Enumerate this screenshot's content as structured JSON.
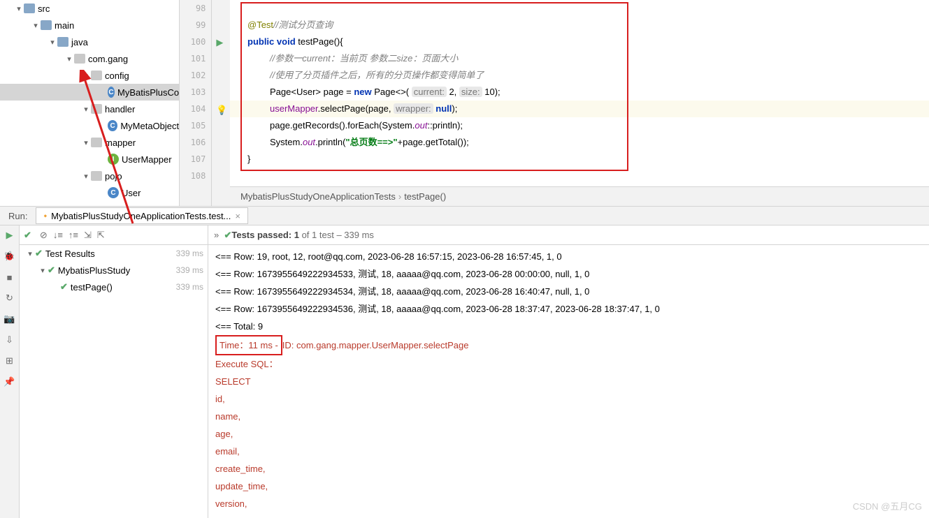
{
  "tree": {
    "src": "src",
    "main": "main",
    "java": "java",
    "pkg": "com.gang",
    "config": "config",
    "mbp": "MyBatisPlusCo",
    "handler": "handler",
    "meta": "MyMetaObject",
    "mapper": "mapper",
    "um": "UserMapper",
    "pojo": "pojo",
    "user": "User"
  },
  "lines": [
    "98",
    "99",
    "100",
    "101",
    "102",
    "103",
    "104",
    "105",
    "106",
    "107",
    "108"
  ],
  "code": {
    "ann": "@Test",
    "com0": "//测试分页查询",
    "kw_pub": "public",
    "kw_void": "void",
    "fn": "testPage(){",
    "com1": "//参数一current：当前页   参数二size：页面大小",
    "com2": "//使用了分页插件之后，所有的分页操作都变得简单了",
    "l3a": "Page<User> page = ",
    "kw_new": "new",
    "l3b": " Page<>( ",
    "h1": "current:",
    "v1": " 2, ",
    "h2": "size:",
    "v2": " 10);",
    "l4a": "userMapper",
    "l4b": ".selectPage(page, ",
    "h3": "wrapper:",
    "kw_null": "null",
    "l4c": ");",
    "l5a": "page.getRecords().forEach(System.",
    "out": "out",
    "l5b": "::println);",
    "l6a": "System.",
    "l6b": ".println(",
    "str": "\"总页数==>\"",
    "l6c": "+page.getTotal());",
    "close": "}"
  },
  "bc": {
    "a": "MybatisPlusStudyOneApplicationTests",
    "b": "testPage()"
  },
  "run": {
    "label": "Run:",
    "tab": "MybatisPlusStudyOneApplicationTests.test..."
  },
  "tbar": {
    "passed": "Tests passed: 1",
    "of": " of 1 test – 339 ms"
  },
  "tests": {
    "root": "Test Results",
    "d0": "339 ms",
    "cls": "MybatisPlusStudy",
    "d1": "339 ms",
    "m": "testPage()",
    "d2": "339 ms"
  },
  "out": {
    "r1": "<==        Row: 19, root, 12, root@qq.com, 2023-06-28 16:57:15, 2023-06-28 16:57:45, 1, 0",
    "r2": "<==        Row: 1673955649222934533, 测试, 18, aaaaa@qq.com, 2023-06-28 00:00:00, null, 1, 0",
    "r3": "<==        Row: 1673955649222934534, 测试, 18, aaaaa@qq.com, 2023-06-28 16:40:47, null, 1, 0",
    "r4": "<==        Row: 1673955649222934536, 测试, 18, aaaaa@qq.com, 2023-06-28 18:37:47, 2023-06-28 18:37:47, 1, 0",
    "tot": "<==      Total: 9",
    "time": " Time：11 ms - ",
    "id": "ID: com.gang.mapper.UserMapper.selectPage",
    "exe": "Execute SQL：",
    "sel": "    SELECT",
    "c1": "        id,",
    "c2": "        name,",
    "c3": "        age,",
    "c4": "        email,",
    "c5": "        create_time,",
    "c6": "        update_time,",
    "c7": "        version,"
  },
  "wm": "CSDN @五月CG"
}
